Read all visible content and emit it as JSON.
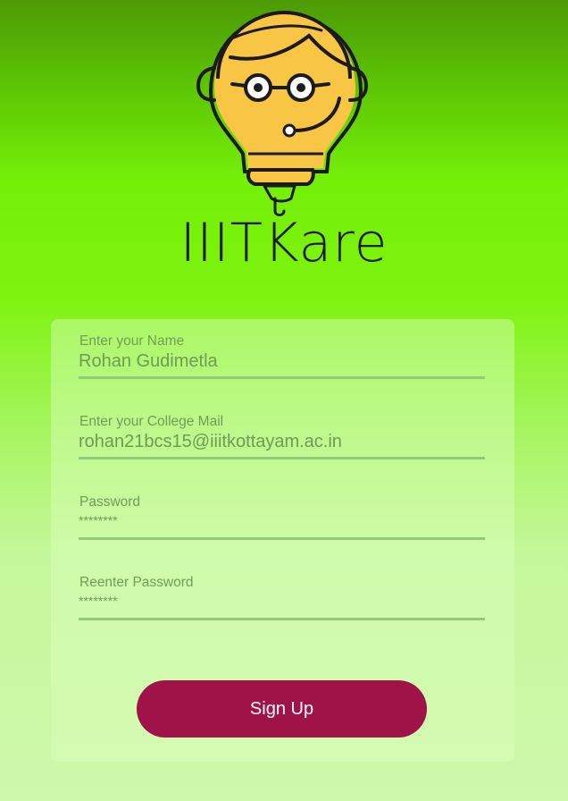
{
  "app": {
    "brand_name": "IIITKare",
    "logo_icon": "lightbulb-mascot-with-headset-icon",
    "colors": {
      "background_top": "#4e9a06",
      "background_mid": "#7df30e",
      "background_bottom": "#cef8ab",
      "bulb": "#f9c544",
      "outline": "#1b1b1b",
      "button": "#a01348",
      "field_text": "#6e9b58"
    }
  },
  "form": {
    "name_label": "Enter your Name",
    "name_value": "Rohan Gudimetla",
    "email_label": "Enter your College Mail",
    "email_value": "rohan21bcs15@iiitkottayam.ac.in",
    "password_label": "Password",
    "password_value": "********",
    "reenter_label": "Reenter Password",
    "reenter_value": "********",
    "signup_label": "Sign Up"
  }
}
